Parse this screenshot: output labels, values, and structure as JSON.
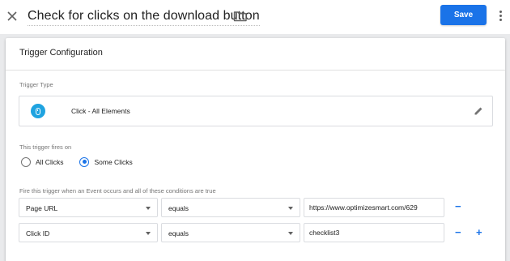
{
  "header": {
    "title": "Check for clicks on the download button",
    "save_label": "Save"
  },
  "card": {
    "title": "Trigger Configuration",
    "trigger_type_label": "Trigger Type",
    "trigger_type_value": "Click - All Elements",
    "fires_on_label": "This trigger fires on",
    "fires_on_options": [
      {
        "label": "All Clicks",
        "selected": false
      },
      {
        "label": "Some Clicks",
        "selected": true
      }
    ],
    "conditions_label": "Fire this trigger when an Event occurs and all of these conditions are true",
    "conditions": [
      {
        "variable": "Page URL",
        "operator": "equals",
        "value": "https://www.optimizesmart.com/629"
      },
      {
        "variable": "Click ID",
        "operator": "equals",
        "value": "checklist3"
      }
    ],
    "remove_label": "−",
    "add_label": "+"
  },
  "colors": {
    "accent": "#1a73e8",
    "click_icon": "#1fa3e0",
    "background": "#e9eaec"
  },
  "icons": [
    "close-icon",
    "folder-icon",
    "more-vert-icon",
    "click-icon",
    "edit-pencil-icon",
    "dropdown-arrow-icon"
  ]
}
